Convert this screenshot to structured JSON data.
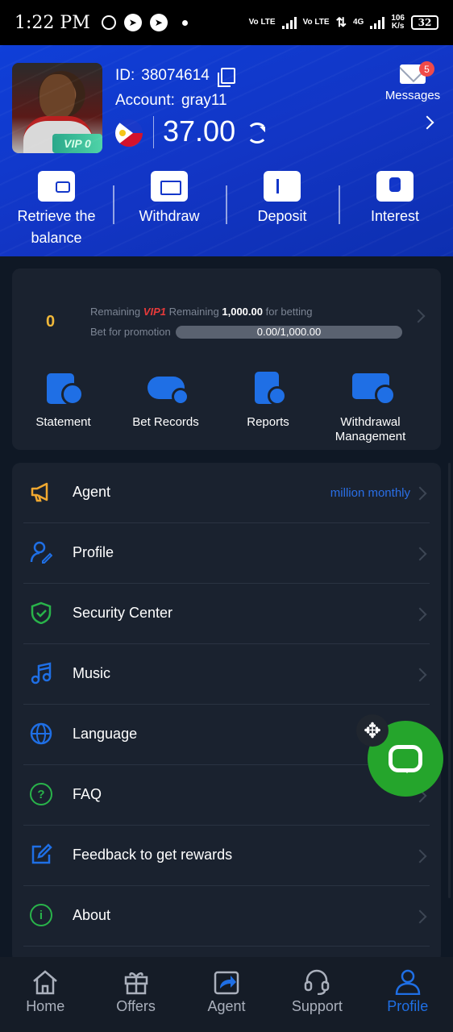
{
  "status_bar": {
    "time": "1:22 PM",
    "speed_value": "106",
    "speed_unit": "K/s",
    "battery": "32",
    "network": "4G",
    "volte": "Vo LTE"
  },
  "profile": {
    "id_label": "ID:",
    "id_value": "38074614",
    "account_label": "Account:",
    "account_value": "gray11",
    "vip_badge": "VIP 0",
    "balance": "37.00",
    "country_flag": "philippines-flag-icon"
  },
  "messages": {
    "label": "Messages",
    "badge": "5"
  },
  "quick_actions": [
    {
      "label": "Retrieve the balance",
      "icon": "wallet-icon"
    },
    {
      "label": "Withdraw",
      "icon": "ticket-icon"
    },
    {
      "label": "Deposit",
      "icon": "card-icon"
    },
    {
      "label": "Interest",
      "icon": "piggy-bank-icon"
    }
  ],
  "vip_progress": {
    "current_level": "0",
    "remaining_label": "Remaining",
    "next_vip": "VIP1",
    "remaining_label_2": "Remaining",
    "remaining_amount": "1,000.00",
    "for_betting": "for betting",
    "bet_label": "Bet for promotion",
    "progress_text": "0.00/1,000.00",
    "progress_fraction": 0
  },
  "tools": [
    {
      "label": "Statement",
      "icon": "statement-icon"
    },
    {
      "label": "Bet Records",
      "icon": "gamepad-icon"
    },
    {
      "label": "Reports",
      "icon": "reports-icon"
    },
    {
      "label": "Withdrawal Management",
      "icon": "card-settings-icon"
    }
  ],
  "menu": [
    {
      "label": "Agent",
      "extra": "million monthly",
      "icon": "megaphone-icon",
      "color": "#f0a830"
    },
    {
      "label": "Profile",
      "extra": "",
      "icon": "user-edit-icon",
      "color": "#1f6fe5"
    },
    {
      "label": "Security Center",
      "extra": "",
      "icon": "shield-icon",
      "color": "#29b34a"
    },
    {
      "label": "Music",
      "extra": "",
      "icon": "music-icon",
      "color": "#1f6fe5"
    },
    {
      "label": "Language",
      "extra": "",
      "icon": "globe-icon",
      "color": "#1f6fe5"
    },
    {
      "label": "FAQ",
      "extra": "",
      "icon": "question-icon",
      "color": "#29b34a"
    },
    {
      "label": "Feedback to get rewards",
      "extra": "",
      "icon": "edit-icon",
      "color": "#1f6fe5"
    },
    {
      "label": "About",
      "extra": "",
      "icon": "info-icon",
      "color": "#29b34a"
    }
  ],
  "bottom_nav": [
    {
      "label": "Home",
      "icon": "home-icon",
      "active": false
    },
    {
      "label": "Offers",
      "icon": "gift-icon",
      "active": false
    },
    {
      "label": "Agent",
      "icon": "share-icon",
      "active": false
    },
    {
      "label": "Support",
      "icon": "headset-icon",
      "active": false
    },
    {
      "label": "Profile",
      "icon": "user-icon",
      "active": true
    }
  ],
  "colors": {
    "accent": "#1f6fe5",
    "header_blue": "#1235c4",
    "chat_green": "#25a52c",
    "badge_red": "#ef4a4a"
  }
}
